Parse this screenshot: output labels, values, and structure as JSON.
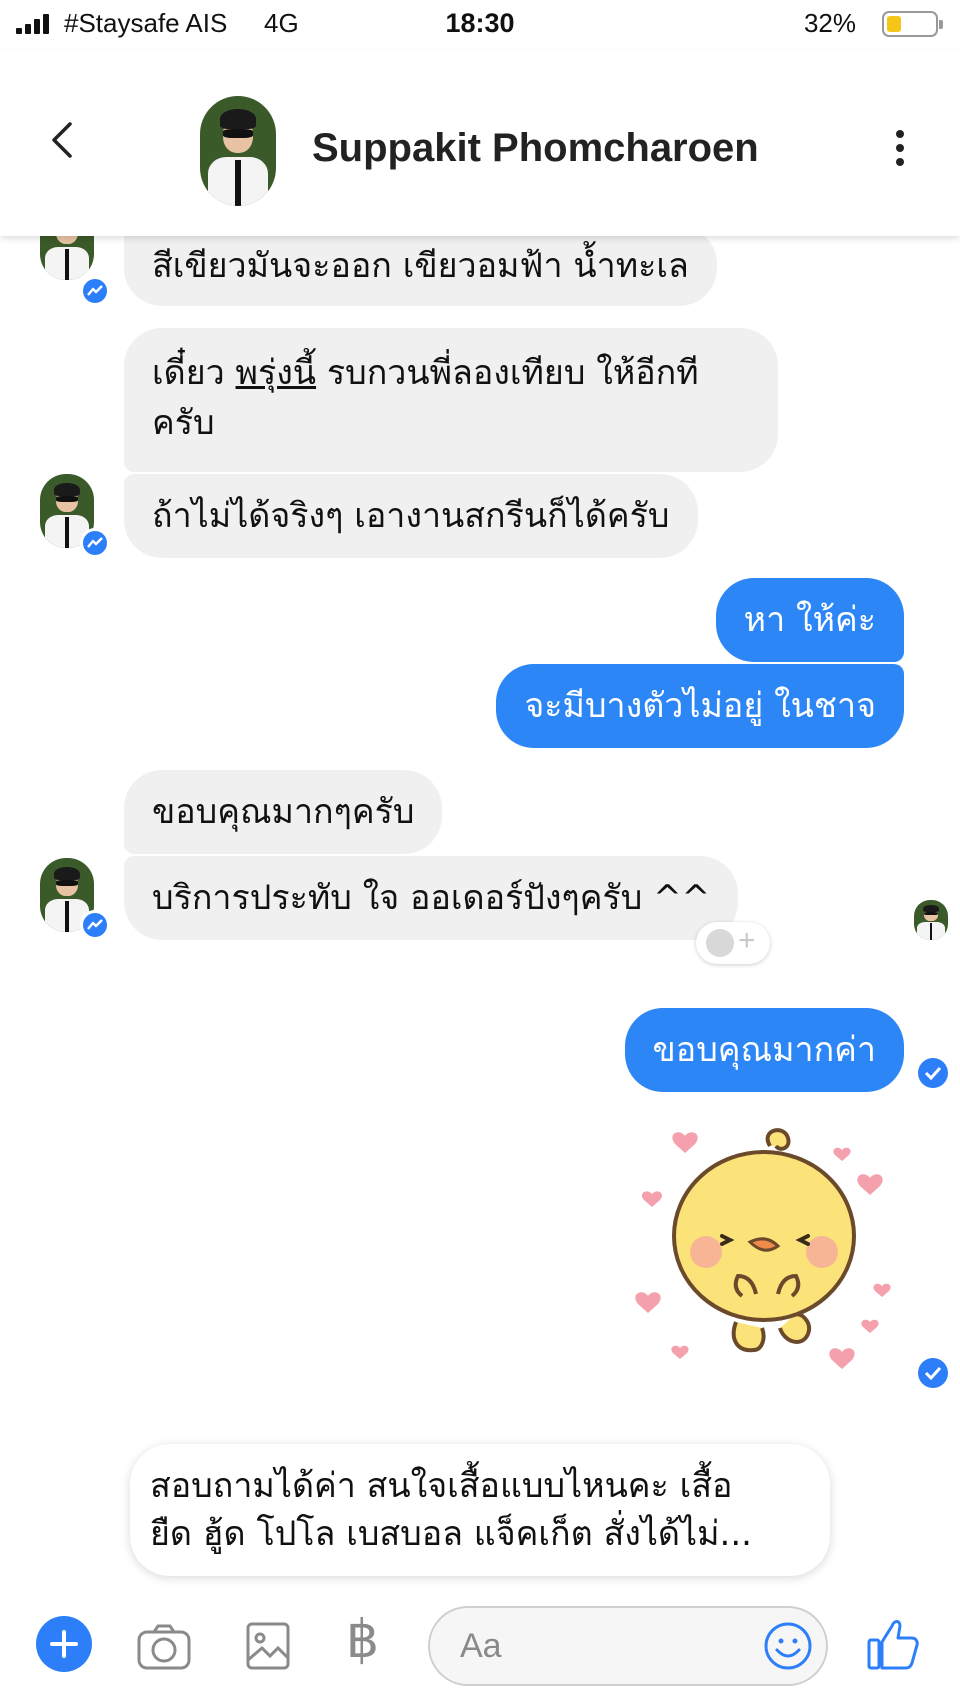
{
  "status_bar": {
    "carrier": "#Staysafe AIS",
    "network": "4G",
    "time": "18:30",
    "battery": "32%",
    "battery_level": 0.32
  },
  "header": {
    "contact_name": "Suppakit Phomcharoen",
    "back_icon": "chevron-left-icon",
    "more_icon": "vertical-dots-icon"
  },
  "messages": [
    {
      "from": "contact",
      "text": "สีเขียวมันจะออก เขียวอมฟ้า น้ำทะเล"
    },
    {
      "from": "contact",
      "line1_pre": "เดี๋ยว ",
      "line1_underlined": "พรุ่งนี้",
      "line1_post": " รบกวนพี่ลองเทียบ ให้อีกที",
      "line2": "ครับ"
    },
    {
      "from": "contact",
      "text": "ถ้าไม่ได้จริงๆ เอางานสกรีนก็ได้ครับ"
    },
    {
      "from": "me",
      "text": "หา ให้ค่ะ"
    },
    {
      "from": "me",
      "text": "จะมีบางตัวไม่อยู่ ในชาจ"
    },
    {
      "from": "contact",
      "text": "ขอบคุณมากๆครับ"
    },
    {
      "from": "contact",
      "text": "บริการประทับ ใจ ออเดอร์ปังๆครับ ^^"
    },
    {
      "from": "me",
      "text": "ขอบคุณมากค่า"
    }
  ],
  "sticker": {
    "name": "yellow-chick-sticker",
    "colors": {
      "body": "#fbe37a",
      "outline": "#6b4a2b",
      "hearts": "#f5a0ad"
    }
  },
  "preview": {
    "line1": "สอบถามได้ค่า สนใจเสื้อแบบไหนคะ เสื้อ",
    "line2": "ยืด ฮู้ด โปโล เบสบอล แจ็คเก็ต สั่งได้ไม่..."
  },
  "composer": {
    "placeholder": "Aa",
    "baht_symbol": "฿"
  },
  "colors": {
    "accent": "#2d7ff9",
    "outgoing_bubble": "#2d86f5",
    "incoming_bubble": "#f0f0f0"
  }
}
